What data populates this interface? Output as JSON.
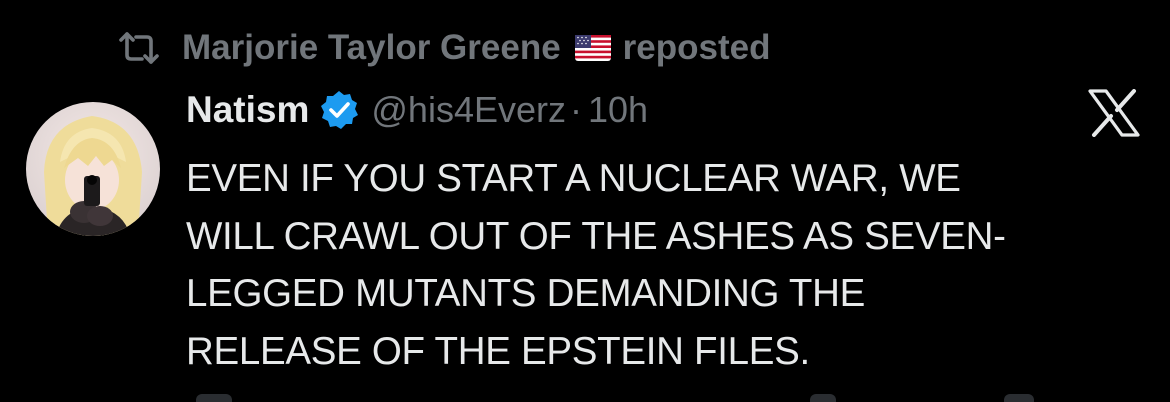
{
  "repost": {
    "icon": "repost-icon",
    "user_name": "Marjorie Taylor Greene",
    "flag_icon": "us-flag-icon",
    "suffix": "reposted"
  },
  "tweet": {
    "avatar_icon": "avatar",
    "display_name": "Natism",
    "verified_icon": "verified-badge-icon",
    "handle": "@his4Everz",
    "separator": "·",
    "time": "10h",
    "platform_icon": "x-logo-icon",
    "lines": [
      "EVEN IF YOU START A NUCLEAR WAR, WE",
      "WILL CRAWL OUT OF THE ASHES AS SEVEN-",
      "LEGGED MUTANTS DEMANDING THE",
      "RELEASE OF THE EPSTEIN FILES."
    ]
  },
  "colors": {
    "background": "#000000",
    "text_primary": "#e7e9ea",
    "text_secondary": "#71767b",
    "verified_blue": "#1d9bf0"
  }
}
